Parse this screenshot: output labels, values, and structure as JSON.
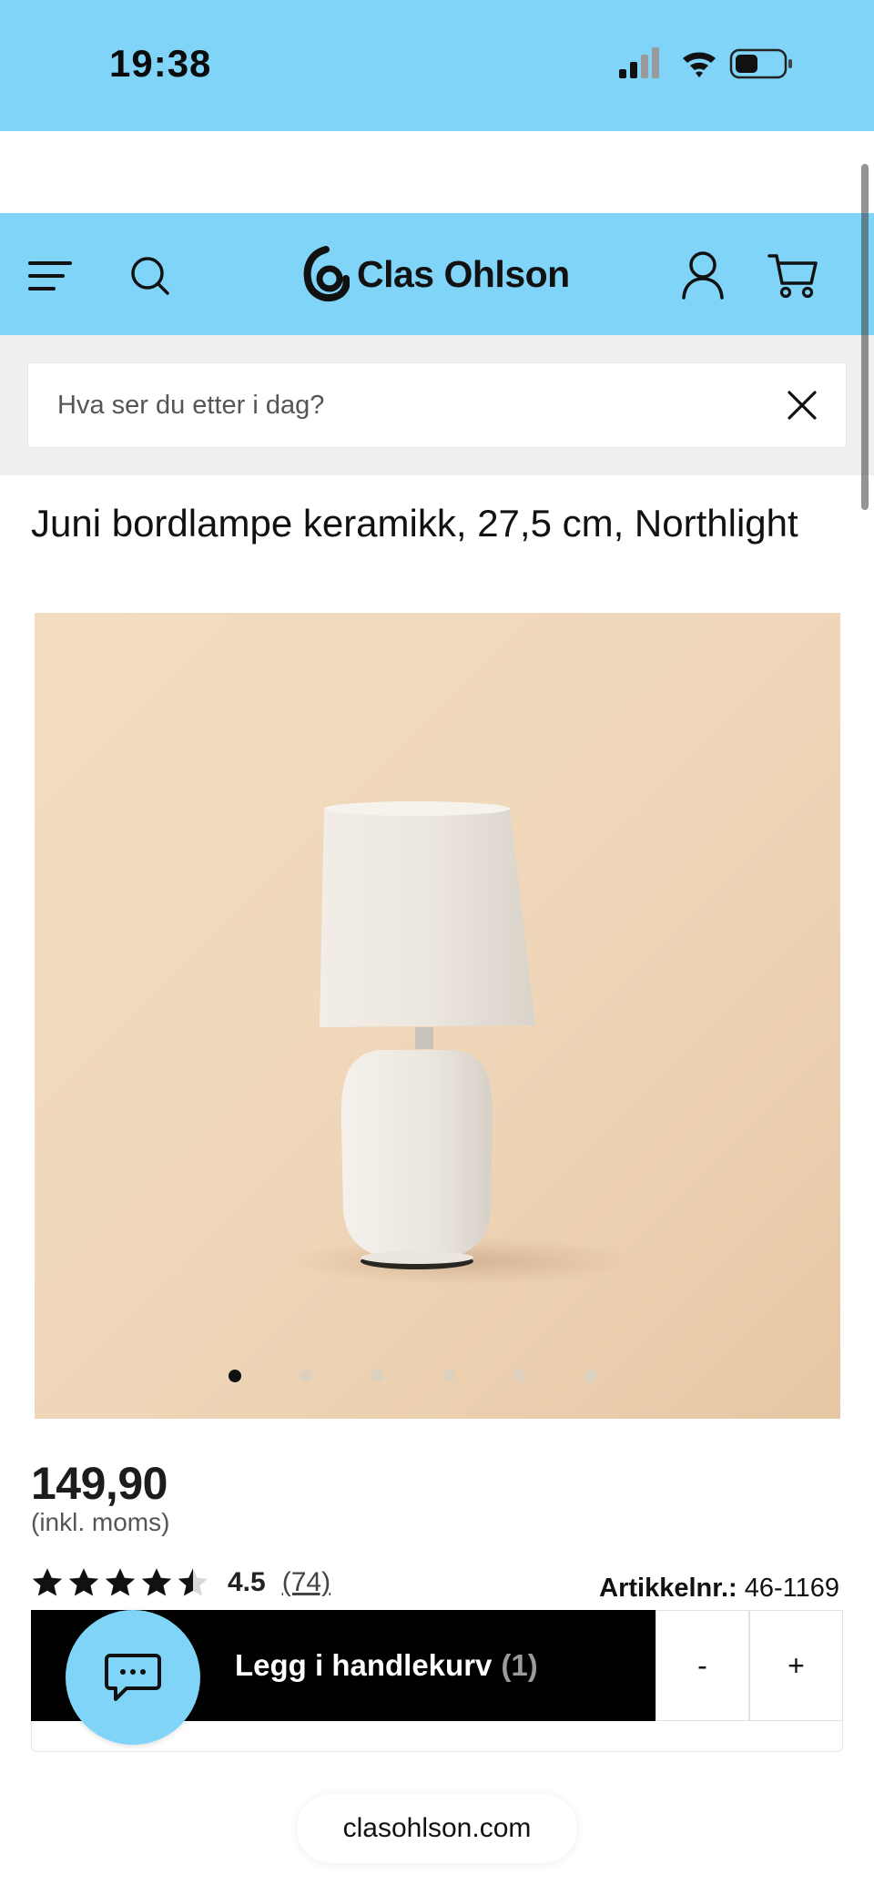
{
  "status_bar": {
    "time": "19:38",
    "icons": [
      "signal-icon",
      "wifi-icon",
      "battery-icon"
    ]
  },
  "header": {
    "brand": "Clas Ohlson",
    "icons": [
      "menu-icon",
      "search-icon",
      "logo-mark",
      "account-icon",
      "cart-icon"
    ],
    "background": "#7fd4f8"
  },
  "search": {
    "placeholder": "Hva ser du etter i dag?",
    "value": ""
  },
  "product": {
    "title": "Juni bordlampe keramikk, 27,5 cm, Northlight",
    "image_count": 6,
    "active_image": 1,
    "price": "149,90",
    "vat_note": "(inkl. moms)",
    "rating": {
      "value": "4.5",
      "count": "(74)",
      "stars_filled": 4.5,
      "stars_total": 5
    },
    "article_label": "Artikkelnr.:",
    "article_number": "46-1169"
  },
  "cart": {
    "add_label": "Legg i handlekurv",
    "quantity": "(1)",
    "minus_label": "-",
    "plus_label": "+"
  },
  "chat": {
    "icon": "chat-icon"
  },
  "url_bar": {
    "domain": "clasohlson.com"
  },
  "colors": {
    "accent": "#7fd4f8",
    "button": "#000000",
    "search_band": "#efefed"
  }
}
